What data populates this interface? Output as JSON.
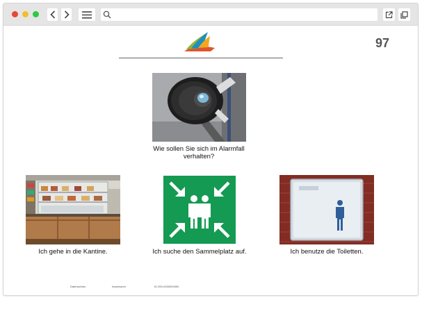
{
  "page": {
    "number": "97"
  },
  "question": {
    "caption": "Wie sollen Sie sich im Alarmfall verhalten?"
  },
  "options": [
    {
      "caption": "Ich gehe in die Kantine."
    },
    {
      "caption": "Ich suche den Sammelplatz auf."
    },
    {
      "caption": "Ich benutze die Toiletten."
    }
  ],
  "footer": {
    "privacy_label": "Datenschutz",
    "imprint_label": "Impressum",
    "id_label": "ID 000-0000000000"
  },
  "colors": {
    "assembly_green": "#149a52",
    "traffic_red": "#e8463c",
    "traffic_yellow": "#f4bd2f",
    "traffic_green": "#2fc843"
  },
  "icons": {
    "back": "chevron-left-icon",
    "forward": "chevron-right-icon",
    "menu": "hamburger-menu-icon",
    "search": "search-icon",
    "external": "external-link-icon",
    "copy": "copy-icon"
  }
}
